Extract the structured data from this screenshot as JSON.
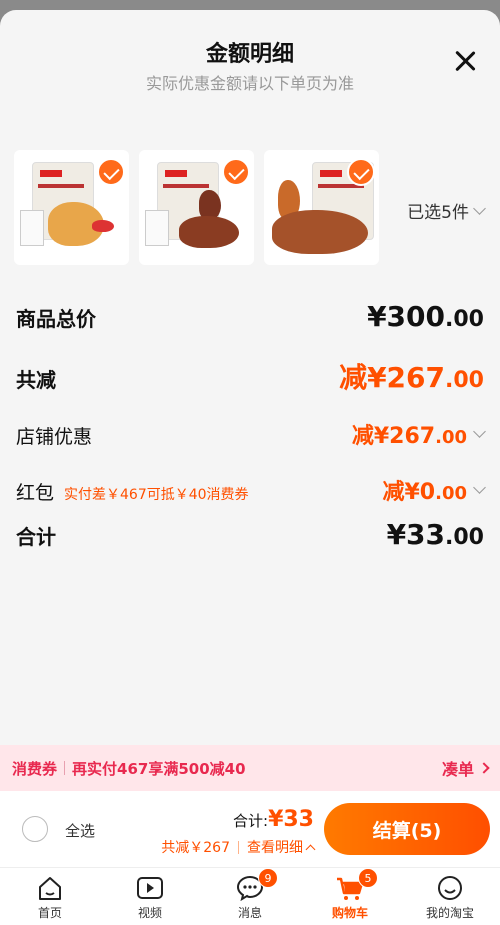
{
  "sheet": {
    "title": "金额明细",
    "subtitle": "实际优惠金额请以下单页为准",
    "selected_count": "已选5件"
  },
  "summary": {
    "total_label": "商品总价",
    "total_int": "¥300",
    "total_dec": ".00",
    "reduce_label": "共减",
    "reduce_int": "减¥267",
    "reduce_dec": ".00",
    "store_label": "店铺优惠",
    "store_int": "减¥267",
    "store_dec": ".00",
    "redpacket_label": "红包",
    "redpacket_hint": "实付差￥467可抵￥40消费券",
    "redpacket_int": "减¥0",
    "redpacket_dec": ".00",
    "sum_label": "合计",
    "sum_int": "¥33",
    "sum_dec": ".00"
  },
  "promo": {
    "tag": "消费券",
    "text": "再实付467享满500减40",
    "link": "凑单"
  },
  "checkout": {
    "select_all": "全选",
    "total_prefix": "合计:",
    "total_amount": "¥33",
    "reduce_text": "共减￥267",
    "detail_link": "查看明细",
    "pay_button": "结算(5)"
  },
  "tabbar": {
    "items": [
      {
        "label": "首页",
        "icon": "home-icon"
      },
      {
        "label": "视频",
        "icon": "video-icon"
      },
      {
        "label": "消息",
        "icon": "message-icon",
        "badge": "9"
      },
      {
        "label": "购物车",
        "icon": "cart-icon",
        "badge": "5"
      },
      {
        "label": "我的淘宝",
        "icon": "profile-icon"
      }
    ]
  },
  "colors": {
    "accent": "#ff5000",
    "promo": "#e8294f"
  }
}
